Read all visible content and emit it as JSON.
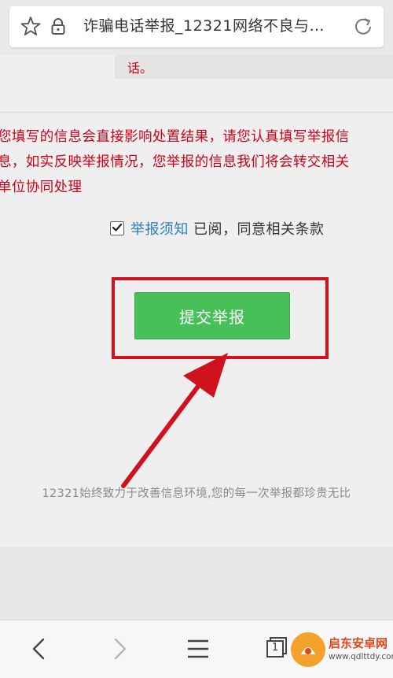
{
  "browser": {
    "url_title": "诈骗电话举报_12321网络不良与…",
    "icons": {
      "bookmark": "star-icon",
      "secure": "lock-icon",
      "reload": "reload-icon"
    }
  },
  "notice": {
    "tail_text": "话。"
  },
  "warning": {
    "lines": [
      "您填写的信息会直接影响处置结果，请您认真填写举报信",
      "息，如实反映举报情况，您举报的信息我们将会转交相关",
      "单位协同处理"
    ]
  },
  "agreement": {
    "checked": true,
    "link_label": "举报须知",
    "text": "已阅，同意相关条款"
  },
  "submit": {
    "label": "提交举报"
  },
  "footer": {
    "text": "12321始终致力于改善信息环境,您的每一次举报都珍贵无比"
  },
  "bottom_nav": {
    "tabs_count": "1",
    "icons": [
      "back-icon",
      "forward-icon",
      "menu-icon",
      "tabs-icon"
    ]
  },
  "watermark": {
    "title": "启东安卓网",
    "url": "www.qdlttdy.com"
  },
  "colors": {
    "warning_red": "#d0021b",
    "highlight_red": "#d0121e",
    "button_green": "#47c057",
    "link_blue": "#2a7fc0"
  }
}
